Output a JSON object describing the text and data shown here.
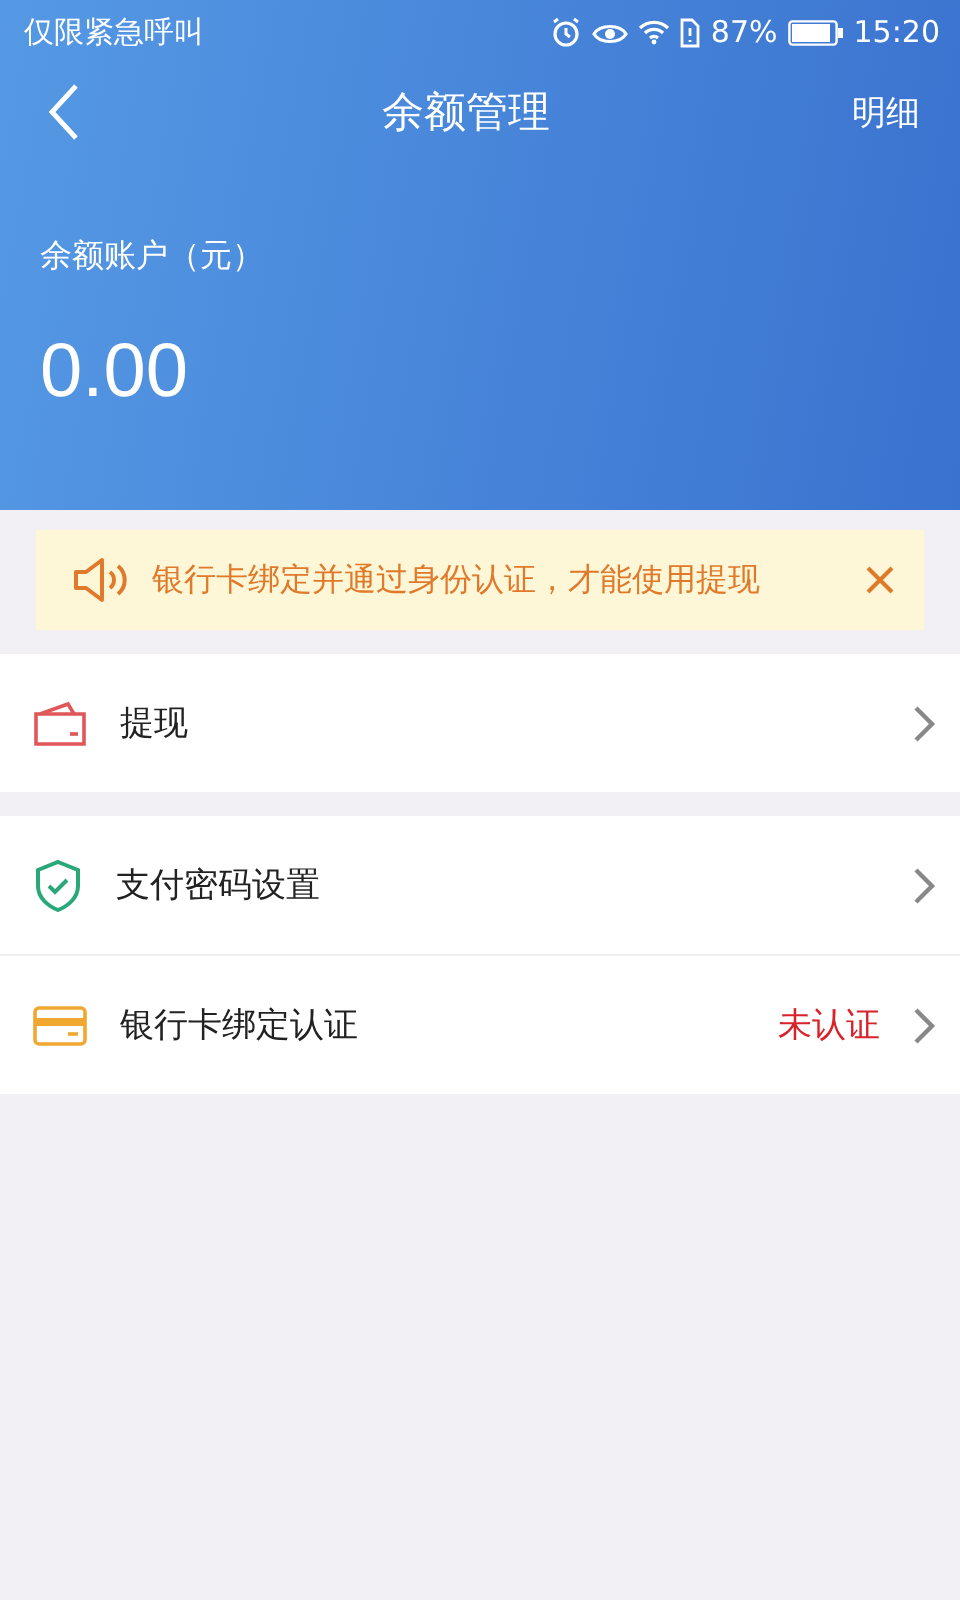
{
  "status_bar": {
    "left_text": "仅限紧急呼叫",
    "battery": "87%",
    "time": "15:20"
  },
  "nav": {
    "title": "余额管理",
    "action": "明细"
  },
  "balance": {
    "label": "余额账户（元）",
    "amount": "0.00"
  },
  "notice": {
    "text": "银行卡绑定并通过身份认证，才能使用提现"
  },
  "menu_groups": [
    {
      "items": [
        {
          "kind": "wallet",
          "label": "提现"
        }
      ]
    },
    {
      "items": [
        {
          "kind": "shield",
          "label": "支付密码设置"
        },
        {
          "kind": "card",
          "label": "银行卡绑定认证",
          "status": "未认证"
        }
      ]
    }
  ]
}
